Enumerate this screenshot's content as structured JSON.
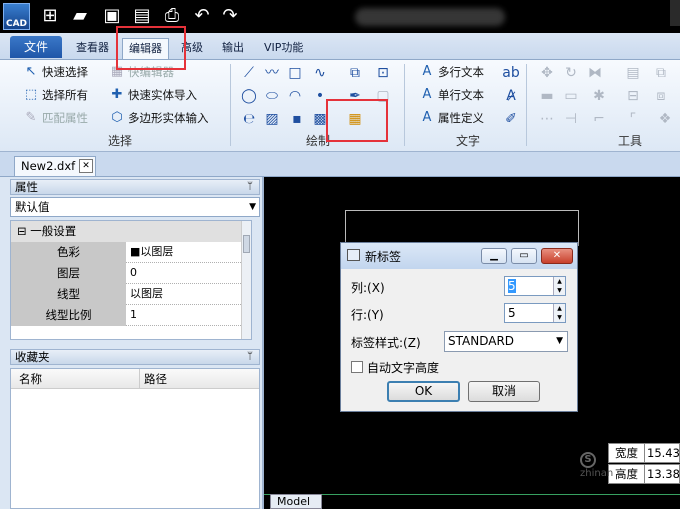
{
  "app": {
    "logo_text": "CAD"
  },
  "quick_access": [
    "new-icon",
    "open-folder-icon",
    "save-icon",
    "save-as-pdf-icon",
    "print-icon",
    "undo-icon",
    "redo-icon"
  ],
  "menu_tabs": [
    "文件",
    "查看器",
    "编辑器",
    "高级",
    "输出",
    "VIP功能"
  ],
  "active_tab": "编辑器",
  "ribbon": {
    "select_group": {
      "label": "选择",
      "items": [
        "快速选择",
        "选择所有",
        "匹配属性",
        "快编辑器",
        "快速实体导入",
        "多边形实体输入"
      ]
    },
    "draw_group": {
      "label": "绘制"
    },
    "text_group": {
      "label": "文字",
      "items": [
        "多行文本",
        "单行文本",
        "属性定义"
      ]
    },
    "tools_group": {
      "label": "工具"
    }
  },
  "document_tab": "New2.dxf",
  "properties_panel": {
    "title": "属性",
    "combo_value": "默认值",
    "section": "一般设置",
    "rows": [
      {
        "key": "色彩",
        "value": "以图层"
      },
      {
        "key": "图层",
        "value": "0"
      },
      {
        "key": "线型",
        "value": "以图层"
      },
      {
        "key": "线型比例",
        "value": "1"
      }
    ]
  },
  "favorites_panel": {
    "title": "收藏夹",
    "columns": [
      "名称",
      "路径"
    ]
  },
  "dialog": {
    "title": "新标签",
    "columns_label": "列:(X)",
    "columns_value": "5",
    "rows_label": "行:(Y)",
    "rows_value": "5",
    "style_label": "标签样式:(Z)",
    "style_value": "STANDARD",
    "auto_text_height": "自动文字高度",
    "ok": "OK",
    "cancel": "取消"
  },
  "readout": [
    {
      "key": "宽度",
      "value": "15.432"
    },
    {
      "key": "高度",
      "value": "13.384"
    }
  ],
  "model_tab": "Model",
  "watermark": "zhinan",
  "colors": {
    "highlight": "#e5323a",
    "canvas": "#000000"
  }
}
